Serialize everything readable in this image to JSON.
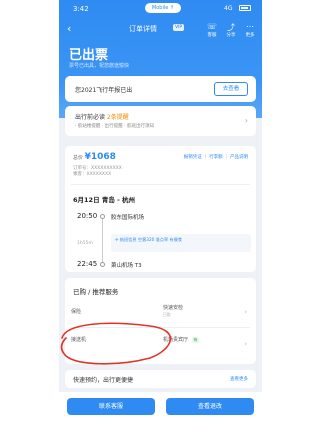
{
  "status_bar": {
    "time": "3:42",
    "pill": "Mobile ↑",
    "network": "4G"
  },
  "nav": {
    "title": "订单详情",
    "vip": "VIP",
    "icons": [
      {
        "name": "service-icon",
        "glyph": "☏",
        "label": "客服"
      },
      {
        "name": "share-icon",
        "glyph": "⤴",
        "label": "分享"
      },
      {
        "name": "more-icon",
        "glyph": "⋯",
        "label": "更多"
      }
    ]
  },
  "status": {
    "title": "已出票",
    "subtitle": "票号已出具，祝您旅途愉快"
  },
  "upgrade": {
    "text": "您2021飞行年报已出",
    "button": "去查看"
  },
  "guide": {
    "title": "出行前必读",
    "badge": "2条提醒",
    "subtitle": "· 航站楼提醒 · 出行提醒 · 航班出行须知"
  },
  "order": {
    "price_label": "总价",
    "price": "¥1068",
    "links": "报销凭证 ｜ 行李额 ｜ 产品说明",
    "line1": "订单号：XXXXXXXXXX",
    "line2": "乘客：XXXXXXXX"
  },
  "route": {
    "title": "6月12日 青岛 - 杭州",
    "dep_time": "20:50",
    "dep_airport": "胶东国际机场",
    "duration": "1h55m",
    "flight_info": "✈ 航班信息  空客320  准点率  有餐食",
    "arr_time": "22:45",
    "arr_airport": "萧山机场 T3"
  },
  "services": {
    "title": "已购 / 推荐服务",
    "items": [
      {
        "label": "保险",
        "sub": "",
        "badge": ""
      },
      {
        "label": "快速安检",
        "sub": "已购",
        "badge": ""
      },
      {
        "label": "接送机",
        "sub": "",
        "badge": ""
      },
      {
        "label": "机场贵宾厅",
        "sub": "",
        "badge": "有"
      }
    ]
  },
  "help": {
    "text": "快速预约，出行更便捷",
    "link": "查看更多"
  },
  "bottom": {
    "left": "联系客服",
    "right": "查看退改"
  },
  "colors": {
    "brand": "#2f8bf2",
    "annotation": "#e0342a"
  }
}
